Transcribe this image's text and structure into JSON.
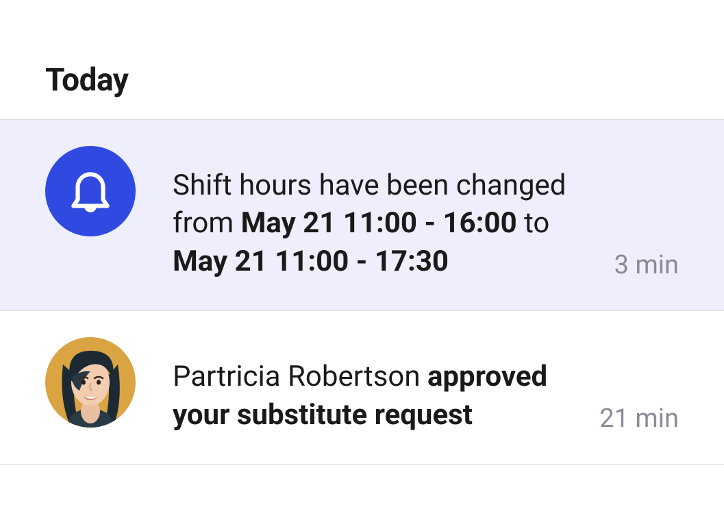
{
  "section": {
    "title": "Today"
  },
  "notifications": [
    {
      "icon": "bell",
      "highlighted": true,
      "message_parts": {
        "p1": "Shift hours have been changed from ",
        "b1": "May 21 11:00 - 16:00",
        "p2": " to ",
        "b2": "May 21 11:00 - 17:30"
      },
      "time": "3 min"
    },
    {
      "icon": "avatar",
      "highlighted": false,
      "message_parts": {
        "p1": "Partricia Robertson ",
        "b1": "approved your substitute request"
      },
      "time": "21 min"
    }
  ]
}
